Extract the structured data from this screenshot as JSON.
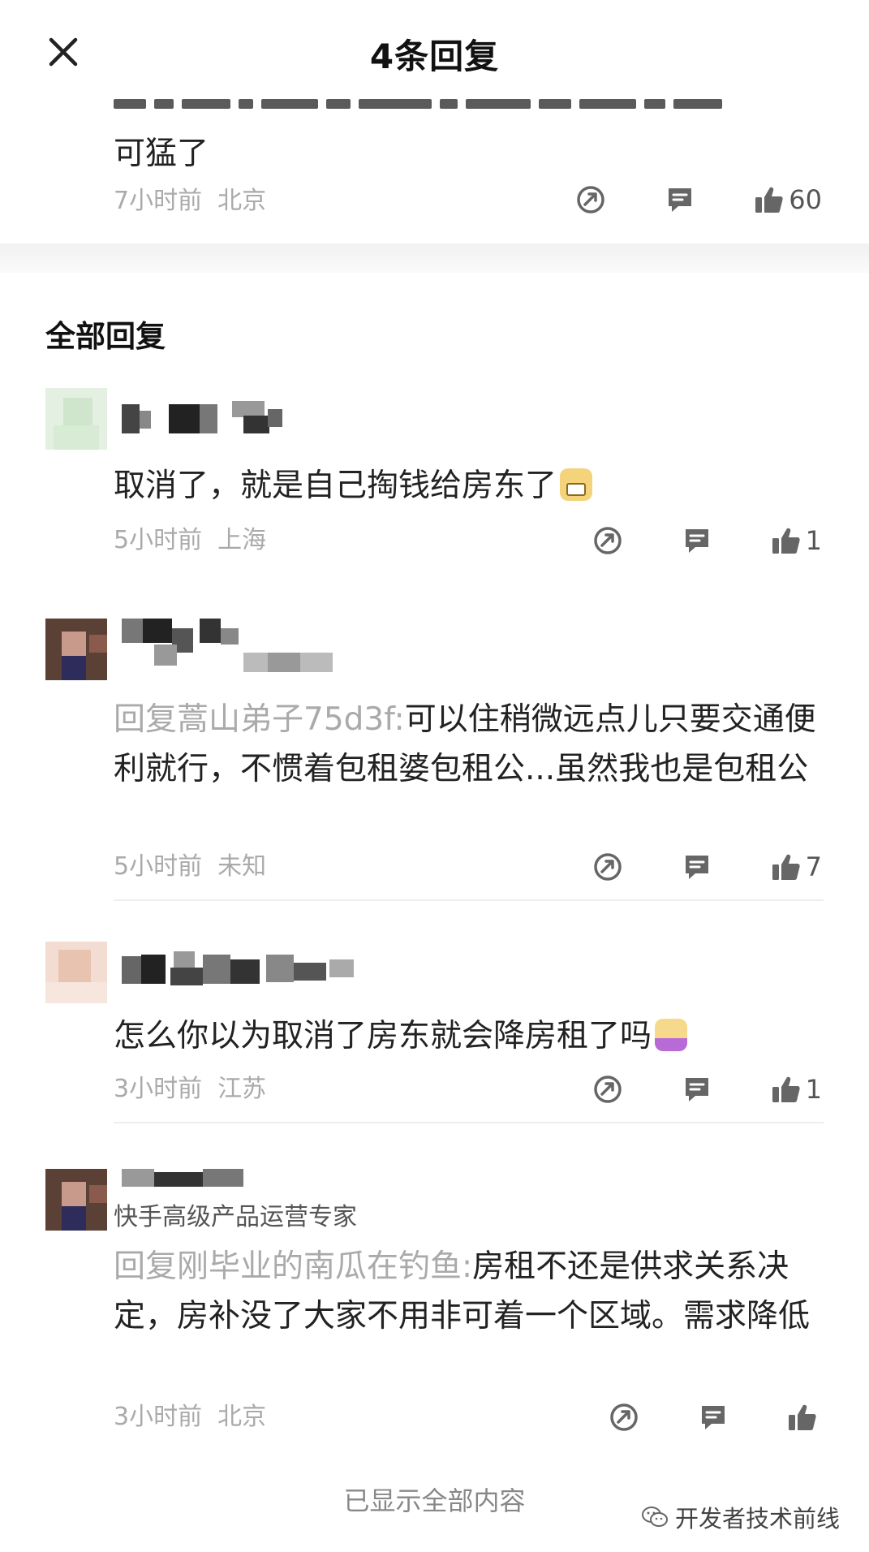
{
  "header": {
    "title": "4条回复"
  },
  "original": {
    "text": "可猛了",
    "time": "7小时前",
    "location": "北京",
    "likes": "60"
  },
  "section_title": "全部回复",
  "replies": [
    {
      "text": "取消了，就是自己掏钱给房东了",
      "emoji": "grin-emoji",
      "time": "5小时前",
      "location": "上海",
      "likes": "1"
    },
    {
      "reply_to": "回复蒿山弟子75d3f:",
      "text": "可以住稍微远点儿只要交通便利就行，不惯着包租婆包租公...虽然我也是包租公",
      "time": "5小时前",
      "location": "未知",
      "likes": "7"
    },
    {
      "text": "怎么你以为取消了房东就会降房租了吗",
      "emoji": "wink-emoji",
      "time": "3小时前",
      "location": "江苏",
      "likes": "1"
    },
    {
      "role": "快手高级产品运营专家",
      "reply_to": "回复刚毕业的南瓜在钓鱼:",
      "text": "房租不还是供求关系决定，房补没了大家不用非可着一个区域。需求降低",
      "time": "3小时前",
      "location": "北京",
      "likes": ""
    }
  ],
  "footer": {
    "text": "已显示全部内容"
  },
  "watermark": {
    "text": "开发者技术前线"
  },
  "colors": {
    "meta": "#aaaaaa",
    "text": "#222222",
    "icon": "#666666"
  }
}
